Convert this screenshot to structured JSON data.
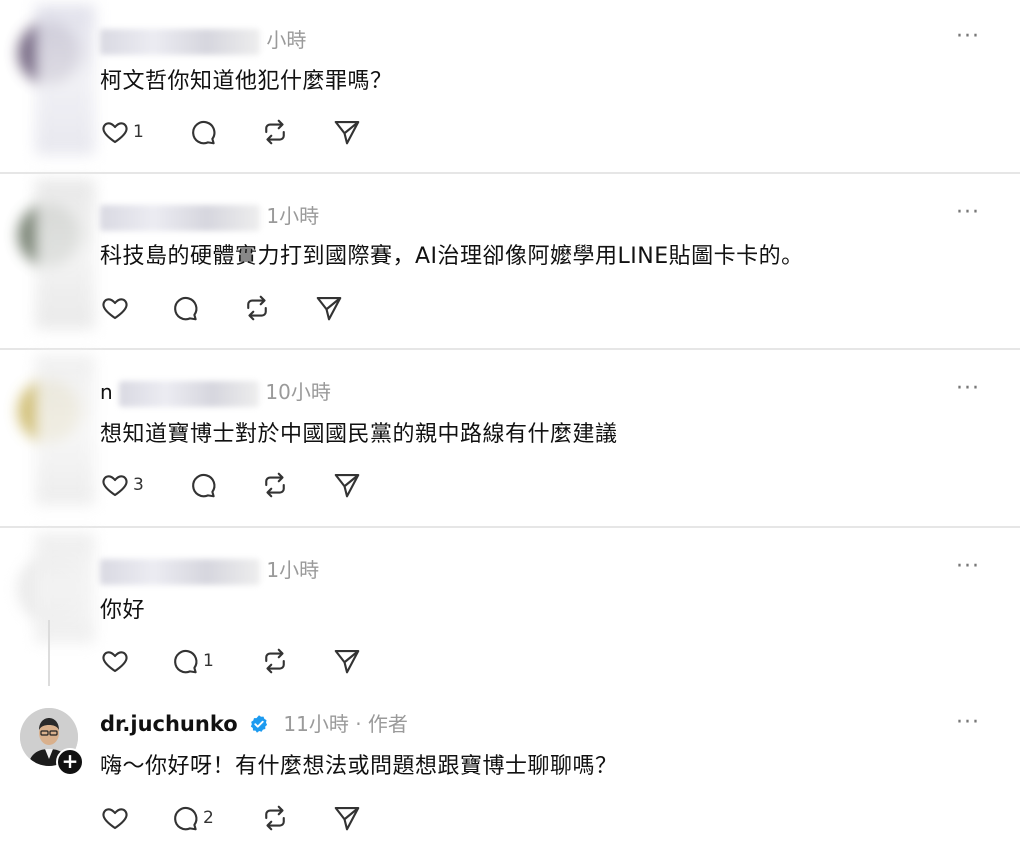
{
  "posts": [
    {
      "time": "小時",
      "text": "柯文哲你知道他犯什麼罪嗎？",
      "like_count": "1",
      "reply_count": "",
      "avatar_color": "#5a4a6a"
    },
    {
      "time": "1小時",
      "text": "科技島的硬體實力打到國際賽，AI治理卻像阿嬤學用LINE貼圖卡卡的。",
      "like_count": "",
      "reply_count": "",
      "avatar_color": "#5e6a58"
    },
    {
      "name_prefix": "n",
      "time": "10小時",
      "text": "想知道寶博士對於中國國民黨的親中路線有什麼建議",
      "like_count": "3",
      "reply_count": "",
      "avatar_color": "#c8b25a"
    },
    {
      "time": "1小時",
      "text": "你好",
      "like_count": "",
      "reply_count": "1",
      "avatar_color": "#e8e8e8"
    }
  ],
  "reply": {
    "username": "dr.juchunko",
    "time": "11小時",
    "separator": "·",
    "author_tag": "作者",
    "text": "嗨～你好呀！有什麼想法或問題想跟寶博士聊聊嗎？",
    "like_count": "",
    "reply_count": "2",
    "verified_color": "#1d9bf0"
  },
  "more_label": "···",
  "icons": [
    "heart-icon",
    "comment-icon",
    "repost-icon",
    "share-icon",
    "more-icon",
    "verified-icon",
    "follow-plus-icon"
  ]
}
